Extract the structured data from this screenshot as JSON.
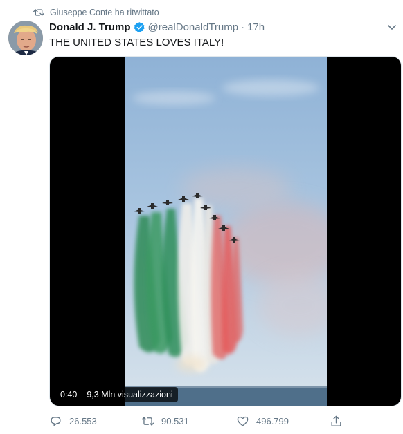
{
  "retweet_context": {
    "text": "Giuseppe Conte ha ritwittato",
    "icon": "retweet-icon"
  },
  "author": {
    "name": "Donald J. Trump",
    "handle": "@realDonaldTrump",
    "separator": "·",
    "time": "17h",
    "verified_icon": "verified-badge-icon"
  },
  "tweet_text": "THE UNITED STATES LOVES ITALY!",
  "media": {
    "type": "video",
    "duration": "0:40",
    "views": "9,3 Mln visualizzazioni"
  },
  "actions": {
    "replies": "26.553",
    "retweets": "90.531",
    "likes": "496.799"
  },
  "colors": {
    "text": "#14171a",
    "secondary": "#657786",
    "verified": "#1da1f2",
    "flag_green": "#2e8b57",
    "flag_white": "#f2f0ec",
    "flag_red": "#e05252"
  }
}
